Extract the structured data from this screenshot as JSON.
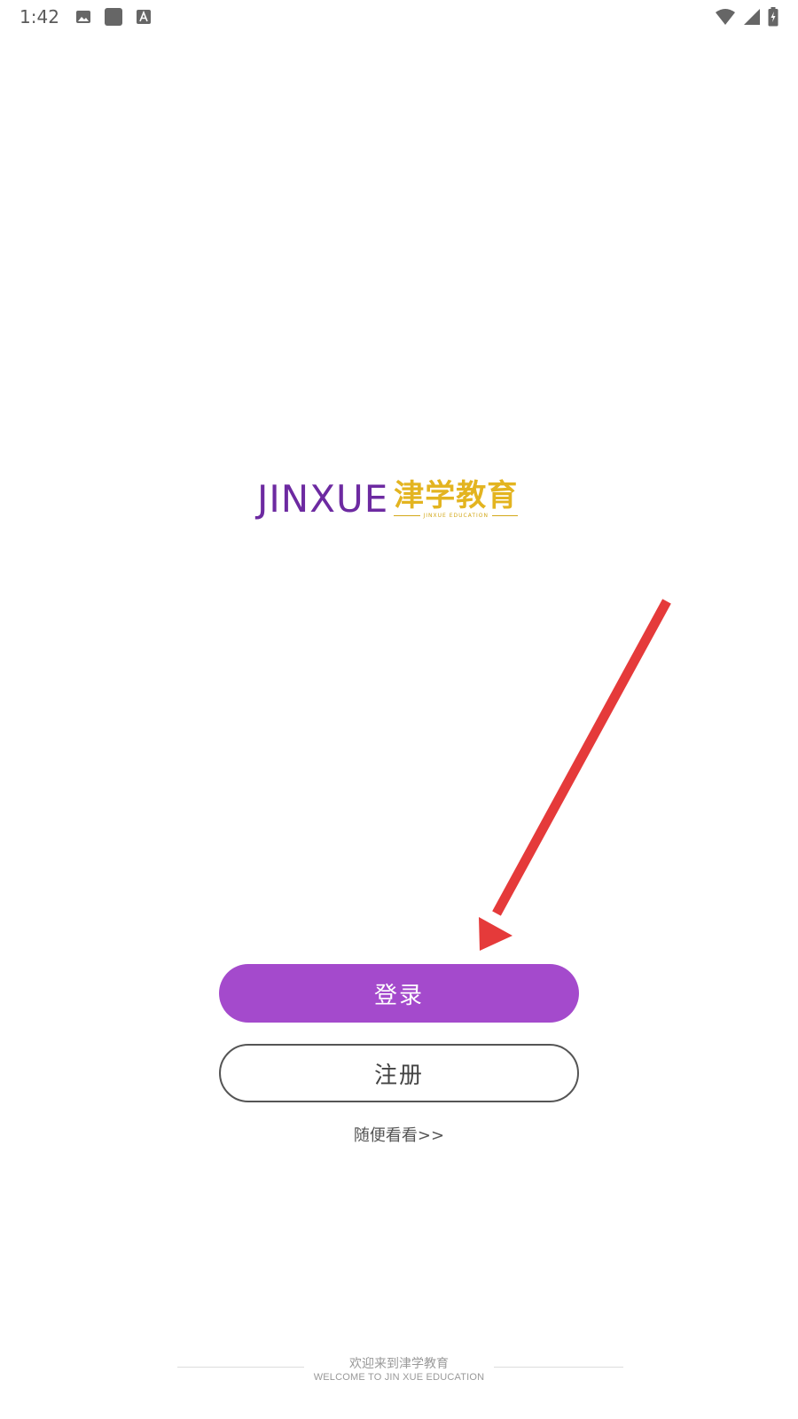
{
  "status_bar": {
    "time": "1:42",
    "icons_left": [
      "image-icon",
      "square-icon",
      "font-icon"
    ],
    "icons_right": [
      "wifi-icon",
      "cellular-signal-icon",
      "battery-charging-icon"
    ]
  },
  "logo": {
    "english": "JINXUE",
    "chinese": "津学教育",
    "subtitle": "JINXUE EDUCATION",
    "colors": {
      "english": "#6d2aa1",
      "chinese": "#e3b420"
    }
  },
  "annotation": {
    "arrow_color": "#e53a3a"
  },
  "actions": {
    "login_label": "登录",
    "register_label": "注册",
    "browse_label": "随便看看>>",
    "login_color": "#a44acc"
  },
  "footer": {
    "welcome_cn": "欢迎来到津学教育",
    "welcome_en": "WELCOME TO JIN XUE EDUCATION"
  }
}
